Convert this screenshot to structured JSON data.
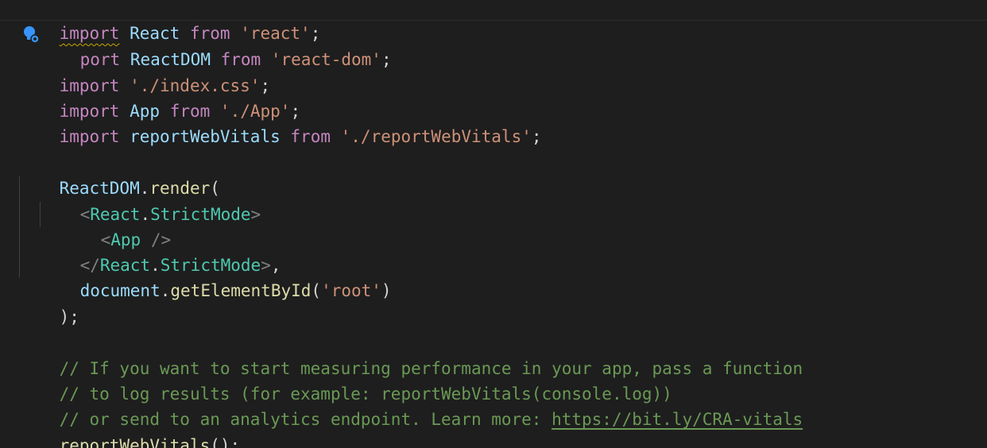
{
  "editor": {
    "lines": {
      "l1": {
        "k1": "import",
        "s1": " ",
        "id1": "React",
        "s2": " ",
        "k2": "from",
        "s3": " ",
        "str1": "'react'",
        "p1": ";"
      },
      "l2": {
        "k1": "port",
        "s1": " ",
        "id1": "ReactDOM",
        "s2": " ",
        "k2": "from",
        "s3": " ",
        "str1": "'react-dom'",
        "p1": ";"
      },
      "l3": {
        "k1": "import",
        "s1": " ",
        "str1": "'./index.css'",
        "p1": ";"
      },
      "l4": {
        "k1": "import",
        "s1": " ",
        "id1": "App",
        "s2": " ",
        "k2": "from",
        "s3": " ",
        "str1": "'./App'",
        "p1": ";"
      },
      "l5": {
        "k1": "import",
        "s1": " ",
        "id1": "reportWebVitals",
        "s2": " ",
        "k2": "from",
        "s3": " ",
        "str1": "'./reportWebVitals'",
        "p1": ";"
      },
      "l7": {
        "id1": "ReactDOM",
        "p1": ".",
        "fn1": "render",
        "p2": "("
      },
      "l8": {
        "b1": "<",
        "t1": "React",
        "p1": ".",
        "t2": "StrictMode",
        "b2": ">"
      },
      "l9": {
        "b1": "<",
        "t1": "App",
        "s1": " ",
        "b2": "/>"
      },
      "l10": {
        "b1": "</",
        "t1": "React",
        "p1": ".",
        "t2": "StrictMode",
        "b2": ">",
        "p2": ","
      },
      "l11": {
        "id1": "document",
        "p1": ".",
        "fn1": "getElementById",
        "p2": "(",
        "str1": "'root'",
        "p3": ")"
      },
      "l12": {
        "p1": ");"
      },
      "l14": {
        "c1": "// If you want to start measuring performance in your app, pass a function"
      },
      "l15": {
        "c1": "// to log results (for example: reportWebVitals(console.log))"
      },
      "l16": {
        "c1": "// or send to an analytics endpoint. Learn more: ",
        "link": "https://bit.ly/CRA-vitals"
      },
      "l17": {
        "fn1": "reportWebVitals",
        "p1": "();"
      }
    },
    "icons": {
      "lightbulb": "lightbulb-icon"
    },
    "colors": {
      "background": "#1e1e1e",
      "keyword": "#c586c0",
      "identifier": "#9cdcfe",
      "string": "#ce9178",
      "function": "#dcdcaa",
      "jsx_tag": "#4ec9b0",
      "comment": "#6a9955",
      "warning_squiggle": "#cca700"
    }
  }
}
